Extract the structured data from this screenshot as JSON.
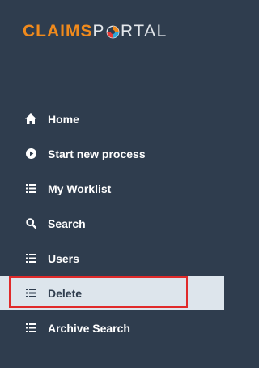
{
  "brand": {
    "part1": "CLAIMS",
    "part2_before": "P",
    "part2_after": "RTAL",
    "logo_mark": "portal-o-mark"
  },
  "nav": {
    "items": [
      {
        "label": "Home",
        "icon": "home-icon"
      },
      {
        "label": "Start new process",
        "icon": "play-circle-icon"
      },
      {
        "label": "My Worklist",
        "icon": "list-icon"
      },
      {
        "label": "Search",
        "icon": "search-icon"
      },
      {
        "label": "Users",
        "icon": "list-icon"
      },
      {
        "label": "Delete",
        "icon": "list-icon",
        "active": true
      },
      {
        "label": "Archive Search",
        "icon": "list-icon"
      }
    ]
  },
  "colors": {
    "sidebar_bg": "#2f3d4e",
    "brand_accent": "#f08a1c",
    "active_bg": "#dde5ec",
    "highlight_border": "#e02a2a"
  }
}
